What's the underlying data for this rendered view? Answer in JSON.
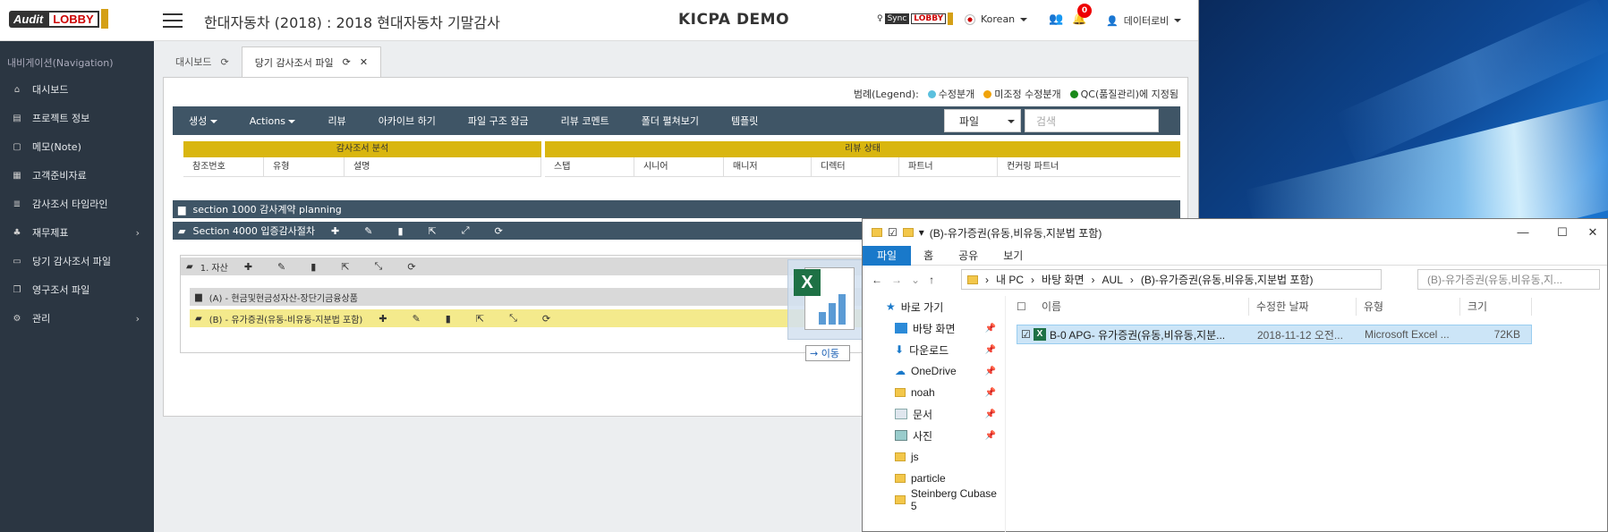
{
  "app": {
    "logo_text_audit": "Audit",
    "logo_text_lobby": "LOBBY",
    "page_title": "한대자동차 (2018) : 2018 현대자동차 기말감사",
    "demo_label": "KICPA DEMO",
    "sync_text_sync": "Sync",
    "sync_text_lobby": "LOBBY",
    "language": "Korean",
    "notification_count": "0",
    "user_name": "데이터로비"
  },
  "sidebar": {
    "heading": "내비게이션(Navigation)",
    "items": [
      {
        "label": "대시보드",
        "icon": "home-icon",
        "glyph": "⌂"
      },
      {
        "label": "프로젝트 정보",
        "icon": "book-icon",
        "glyph": "▤"
      },
      {
        "label": "메모(Note)",
        "icon": "note-icon",
        "glyph": "▢"
      },
      {
        "label": "고객준비자료",
        "icon": "calendar-icon",
        "glyph": "▦"
      },
      {
        "label": "감사조서 타임라인",
        "icon": "database-icon",
        "glyph": "≣"
      },
      {
        "label": "재무제표",
        "icon": "sitemap-icon",
        "glyph": "♣",
        "arrow": "›"
      },
      {
        "label": "당기 감사조서 파일",
        "icon": "file-icon",
        "glyph": "▭"
      },
      {
        "label": "영구조서 파일",
        "icon": "copy-icon",
        "glyph": "❐"
      },
      {
        "label": "관리",
        "icon": "gear-icon",
        "glyph": "⚙",
        "arrow": "›"
      }
    ]
  },
  "tabs": [
    {
      "label": "대시보드"
    },
    {
      "label": "당기 감사조서 파일"
    }
  ],
  "legend": {
    "title": "범례(Legend):",
    "items": [
      {
        "label": "수정분개",
        "color": "#5bc0de"
      },
      {
        "label": "미조정 수정분개",
        "color": "#f0a30a"
      },
      {
        "label": "QC(품질관리)에 지정됨",
        "color": "#1a8a1a"
      }
    ]
  },
  "toolbar": {
    "items": [
      "생성",
      "Actions",
      "리뷰",
      "아카이브 하기",
      "파일 구조 잠금",
      "리뷰 코멘트",
      "폴더 펼쳐보기",
      "템플릿"
    ],
    "select_value": "파일",
    "search_placeholder": "검색"
  },
  "columns": {
    "group1": "감사조서 분석",
    "group2": "리뷰 상태",
    "group1_cols": [
      "참조번호",
      "유형",
      "설명"
    ],
    "group2_cols": [
      "스탭",
      "시니어",
      "매니저",
      "디렉터",
      "파트너",
      "컨커링 파트너"
    ]
  },
  "folders": {
    "section1000": "section 1000 감사계약 planning",
    "section4000": "Section 4000 입증감사절차",
    "assets": "1. 자산",
    "sub_a": "(A) - 현금및현금성자산-장단기금융상품",
    "sub_b": "(B) - 유가증권(유동-비유동-지분법 포함)"
  },
  "drag": {
    "move_label": "이동"
  },
  "explorer": {
    "title": "(B)-유가증권(유동,비유동,지분법 포함)",
    "ribbon": [
      "파일",
      "홈",
      "공유",
      "보기"
    ],
    "path": [
      "내 PC",
      "바탕 화면",
      "AUL",
      "(B)-유가증권(유동,비유동,지분법 포함)"
    ],
    "search_placeholder": "(B)-유가증권(유동,비유동,지...",
    "tree": [
      {
        "label": "바로 가기",
        "icon": "star-icon"
      },
      {
        "label": "바탕 화면",
        "icon": "desktop-icon",
        "pinned": true
      },
      {
        "label": "다운로드",
        "icon": "download-icon",
        "pinned": true
      },
      {
        "label": "OneDrive",
        "icon": "cloud-icon",
        "pinned": true
      },
      {
        "label": "noah",
        "icon": "folder-icon",
        "pinned": true
      },
      {
        "label": "문서",
        "icon": "document-icon",
        "pinned": true
      },
      {
        "label": "사진",
        "icon": "picture-icon",
        "pinned": true
      },
      {
        "label": "js",
        "icon": "folder-icon"
      },
      {
        "label": "particle",
        "icon": "folder-icon"
      },
      {
        "label": "Steinberg Cubase 5",
        "icon": "folder-icon"
      }
    ],
    "columns": [
      "이름",
      "수정한 날짜",
      "유형",
      "크기"
    ],
    "file": {
      "name": "B-0 APG- 유가증권(유동,비유동,지분...",
      "modified": "2018-11-12 오전...",
      "type": "Microsoft Excel ...",
      "size": "72KB"
    }
  }
}
